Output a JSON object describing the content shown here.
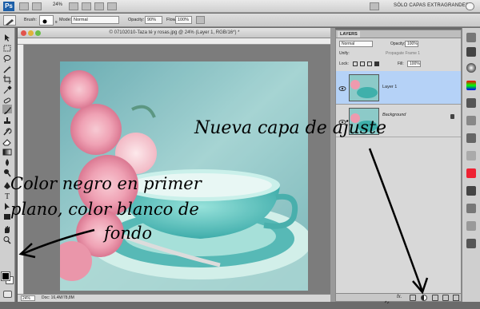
{
  "appbar": {
    "zoom": "24%",
    "workspace": "SÓLO CAPAS EXTRAGRANDES",
    "app_badge": "Ps"
  },
  "options": {
    "brush_label": "Brush:",
    "brush_size": "9",
    "mode_label": "Mode:",
    "mode_value": "Normal",
    "opacity_label": "Opacity:",
    "opacity_value": "90%",
    "flow_label": "Flow:",
    "flow_value": "100%"
  },
  "document": {
    "title": "© 07102010-Taza té y rosas.jpg @ 24% (Layer 1, RGB/16*) *",
    "status_zoom": "24%",
    "status_doc": "Doc: 16,4M/78,8M"
  },
  "layers_panel": {
    "tab": "LAYERS",
    "blend_mode": "Normal",
    "opacity_label": "Opacity:",
    "opacity_value": "100%",
    "unify_label": "Unify:",
    "propagate_label": "Propagate Frame 1",
    "lock_label": "Lock:",
    "fill_label": "Fill:",
    "fill_value": "100%",
    "layers": [
      {
        "name": "Layer 1",
        "selected": true
      },
      {
        "name": "Background",
        "selected": false
      }
    ]
  },
  "annotations": {
    "foreground_line1": "Color negro en primer",
    "foreground_line2": "plano, color blanco de",
    "foreground_line3": "fondo",
    "adjustment": "Nueva capa de ajuste"
  },
  "colors": {
    "foreground": "#000000",
    "background": "#ffffff",
    "selected_layer": "#b5d2f7"
  },
  "icons": [
    "move-icon",
    "marquee-icon",
    "lasso-icon",
    "wand-icon",
    "crop-icon",
    "eyedropper-icon",
    "healing-icon",
    "brush-icon",
    "stamp-icon",
    "history-brush-icon",
    "eraser-icon",
    "gradient-icon",
    "blur-icon",
    "dodge-icon",
    "pen-icon",
    "type-icon",
    "path-select-icon",
    "shape-icon",
    "hand-icon",
    "zoom-icon",
    "eye-icon",
    "link-icon",
    "fx-icon",
    "mask-icon",
    "adjustment-layer-icon",
    "folder-icon",
    "new-layer-icon",
    "trash-icon"
  ]
}
